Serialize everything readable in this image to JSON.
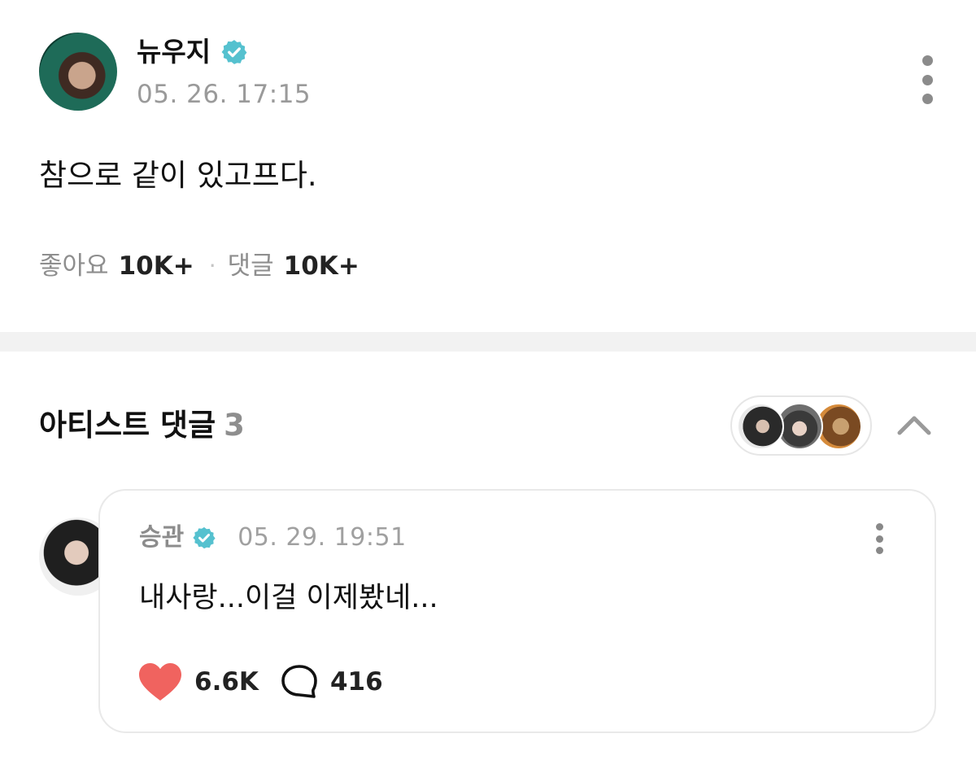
{
  "post": {
    "author_name": "뉴우지",
    "timestamp": "05. 26. 17:15",
    "body": "참으로 같이 있고프다.",
    "stats": {
      "likes_label": "좋아요",
      "likes_value": "10K+",
      "separator": "·",
      "comments_label": "댓글",
      "comments_value": "10K+"
    }
  },
  "artist_comments": {
    "title": "아티스트 댓글",
    "count": "3",
    "comment": {
      "author_name": "승관",
      "timestamp": "05. 29. 19:51",
      "text": "내사랑...이걸 이제봤네...",
      "like_count": "6.6K",
      "reply_count": "416"
    }
  },
  "colors": {
    "verified_badge": "#55c1cf",
    "heart": "#f0635f",
    "muted_text": "#9a9a9a",
    "divider": "#f2f2f2"
  },
  "icons": {
    "verified": "verified-badge-icon",
    "more": "more-vertical-icon",
    "collapse": "chevron-up-icon",
    "like": "heart-icon",
    "reply": "speech-bubble-icon"
  }
}
